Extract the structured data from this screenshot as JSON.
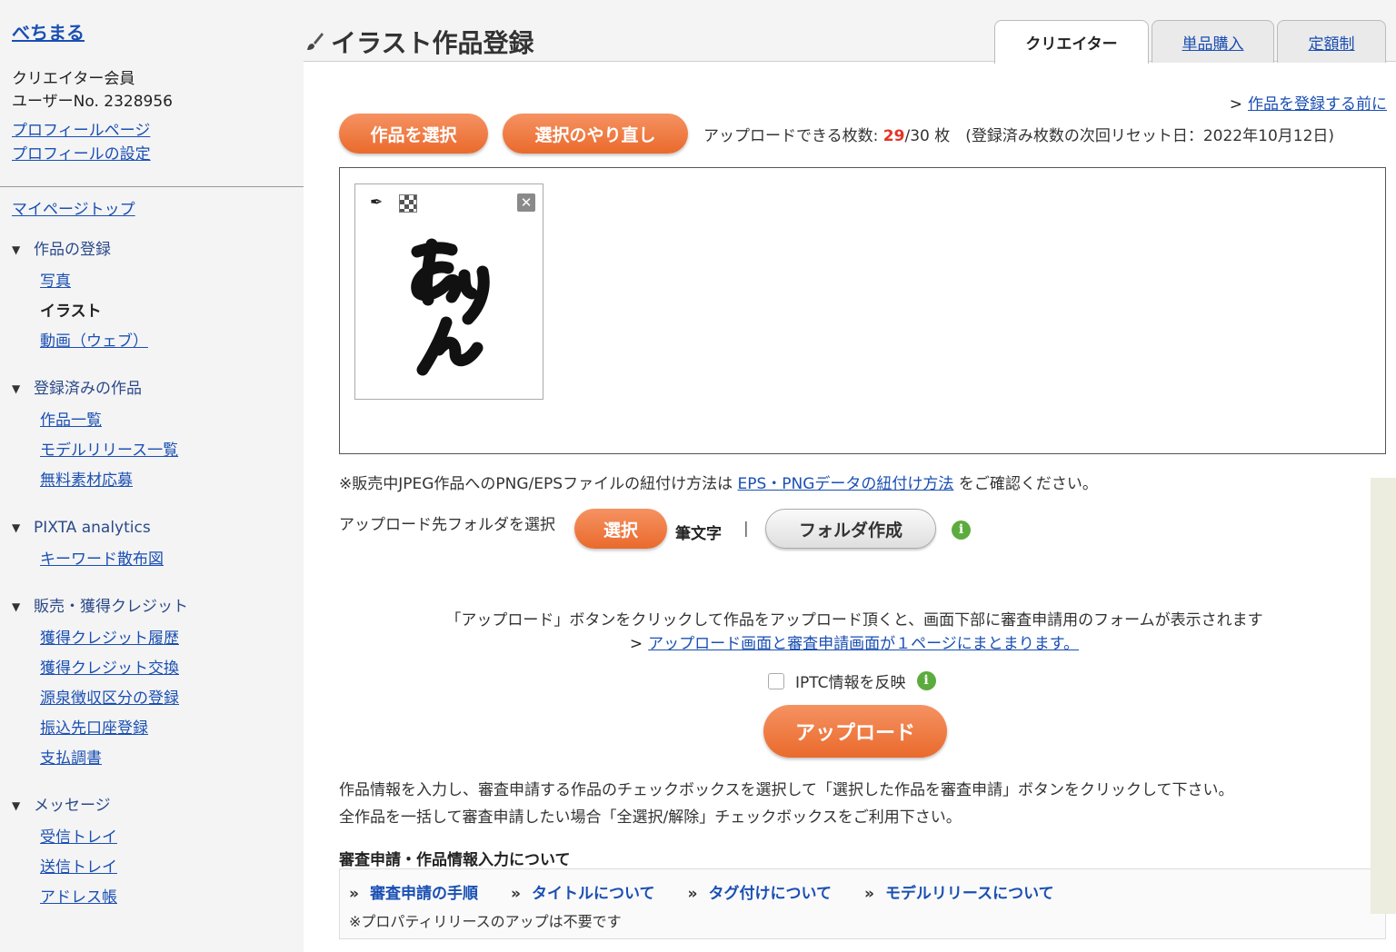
{
  "sidebar": {
    "username": "べちまる",
    "member_type": "クリエイター会員",
    "user_no": "ユーザーNo. 2328956",
    "profile_links": [
      "プロフィールページ",
      "プロフィールの設定"
    ],
    "mypage_top": "マイページトップ",
    "sections": [
      {
        "heading": "作品の登録",
        "items": [
          "写真",
          "イラスト",
          "動画（ウェブ）"
        ],
        "current": "イラスト"
      },
      {
        "heading": "登録済みの作品",
        "items": [
          "作品一覧",
          "モデルリリース一覧",
          "無料素材応募"
        ]
      },
      {
        "heading": "PIXTA analytics",
        "items": [
          "キーワード散布図"
        ]
      },
      {
        "heading": "販売・獲得クレジット",
        "items": [
          "獲得クレジット履歴",
          "獲得クレジット交換",
          "源泉徴収区分の登録",
          "振込先口座登録",
          "支払調書"
        ]
      },
      {
        "heading": "メッセージ",
        "items": [
          "受信トレイ",
          "送信トレイ",
          "アドレス帳"
        ]
      }
    ]
  },
  "header": {
    "title": "イラスト作品登録",
    "tabs": [
      "クリエイター",
      "単品購入",
      "定額制"
    ],
    "active_tab": "クリエイター"
  },
  "main": {
    "before_register_arrow": ">",
    "before_register_link": "作品を登録する前に",
    "select_button": "作品を選択",
    "reselect_button": "選択のやり直し",
    "upload_count_label": "アップロードできる枚数: ",
    "upload_count_current": "29",
    "upload_count_rest": "/30 枚　(登録済み枚数の次回リセット日：2022年10月12日)",
    "thumbnail_text": "みりん",
    "note_prefix": "※販売中JPEG作品へのPNG/EPSファイルの紐付け方法は ",
    "note_link": "EPS・PNGデータの紐付け方法",
    "note_suffix": " をご確認ください。",
    "folder_label": "アップロード先フォルダを選択",
    "folder_select_button": "選択",
    "folder_name": "筆文字",
    "folder_separator": "|",
    "folder_create_button": "フォルダ作成",
    "info_note": "「アップロード」ボタンをクリックして作品をアップロード頂くと、画面下部に審査申請用のフォームが表示されます",
    "info_link_arrow": ">",
    "info_link": "アップロード画面と審査申請画面が１ページにまとまります。",
    "iptc_label": "IPTC情報を反映",
    "upload_button": "アップロード",
    "instruction_1": "作品情報を入力し、審査申請する作品のチェックボックスを選択して「選択した作品を審査申請」ボタンをクリックして下さい。",
    "instruction_2": "全作品を一括して審査申請したい場合「全選択/解除」チェックボックスをご利用下さい。",
    "about_title": "審査申請・作品情報入力について",
    "help_links": [
      "審査申請の手順",
      "タイトルについて",
      "タグ付けについて",
      "モデルリリースについて"
    ],
    "help_bullet": "»",
    "help_note": "※プロパティリリースのアップは不要です"
  },
  "colors": {
    "accent_orange": "#ea6a2c",
    "link_blue": "#1a4fb3",
    "count_red": "#e53327",
    "info_green": "#5cab3e"
  }
}
